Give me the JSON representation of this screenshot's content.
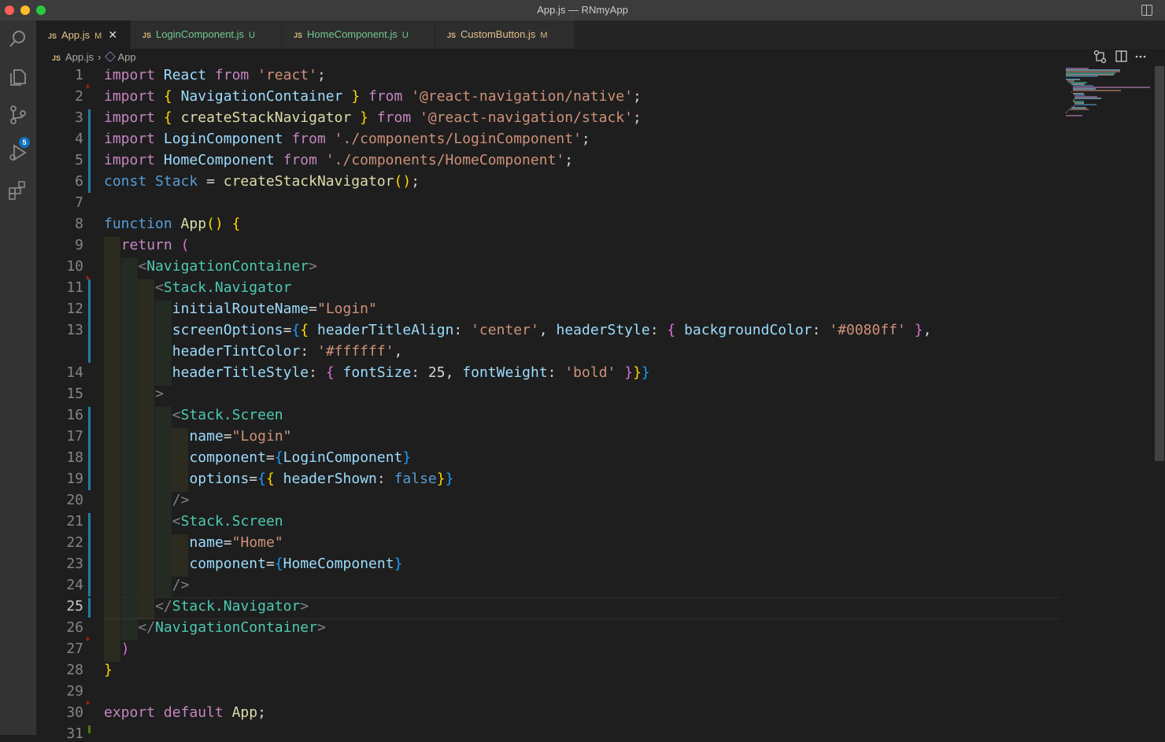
{
  "window": {
    "title": "App.js — RNmyApp"
  },
  "tabs": [
    {
      "label": "App.js",
      "status": "M",
      "active": true
    },
    {
      "label": "LoginComponent.js",
      "status": "U",
      "active": false
    },
    {
      "label": "HomeComponent.js",
      "status": "U",
      "active": false
    },
    {
      "label": "CustomButton.js",
      "status": "M",
      "active": false
    }
  ],
  "breadcrumb": {
    "file": "App.js",
    "symbol": "App"
  },
  "activity": {
    "scm_badge": "5"
  },
  "editor": {
    "current_line": 25,
    "gutter": [
      "1",
      "2",
      "3",
      "4",
      "5",
      "6",
      "7",
      "8",
      "9",
      "10",
      "11",
      "12",
      "13",
      "",
      "14",
      "15",
      "16",
      "17",
      "18",
      "19",
      "20",
      "21",
      "22",
      "23",
      "24",
      "25",
      "26",
      "27",
      "28",
      "29",
      "30",
      "31"
    ],
    "code_lines": [
      "import React from 'react';",
      "import { NavigationContainer } from '@react-navigation/native';",
      "import { createStackNavigator } from '@react-navigation/stack';",
      "import LoginComponent from './components/LoginComponent';",
      "import HomeComponent from './components/HomeComponent';",
      "const Stack = createStackNavigator();",
      "",
      "function App() {",
      "  return (",
      "    <NavigationContainer>",
      "      <Stack.Navigator",
      "        initialRouteName=\"Login\"",
      "        screenOptions={{ headerTitleAlign: 'center', headerStyle: { backgroundColor: '#0080ff' },",
      "        headerTintColor: '#ffffff',",
      "        headerTitleStyle: { fontSize: 25, fontWeight: 'bold' }}}",
      "      >",
      "        <Stack.Screen",
      "          name=\"Login\"",
      "          component={LoginComponent}",
      "          options={{ headerShown: false}}",
      "        />",
      "        <Stack.Screen",
      "          name=\"Home\"",
      "          component={HomeComponent}",
      "        />",
      "      </Stack.Navigator>",
      "    </NavigationContainer>",
      "  )",
      "}",
      "",
      "export default App;",
      ""
    ]
  },
  "colors": {
    "keyword": "#c586c0",
    "storage": "#569cd6",
    "function": "#dcdcaa",
    "string": "#ce9178",
    "variable": "#9cdcfe",
    "tag": "#4ec9b0",
    "git_modified": "#1b81a8"
  }
}
